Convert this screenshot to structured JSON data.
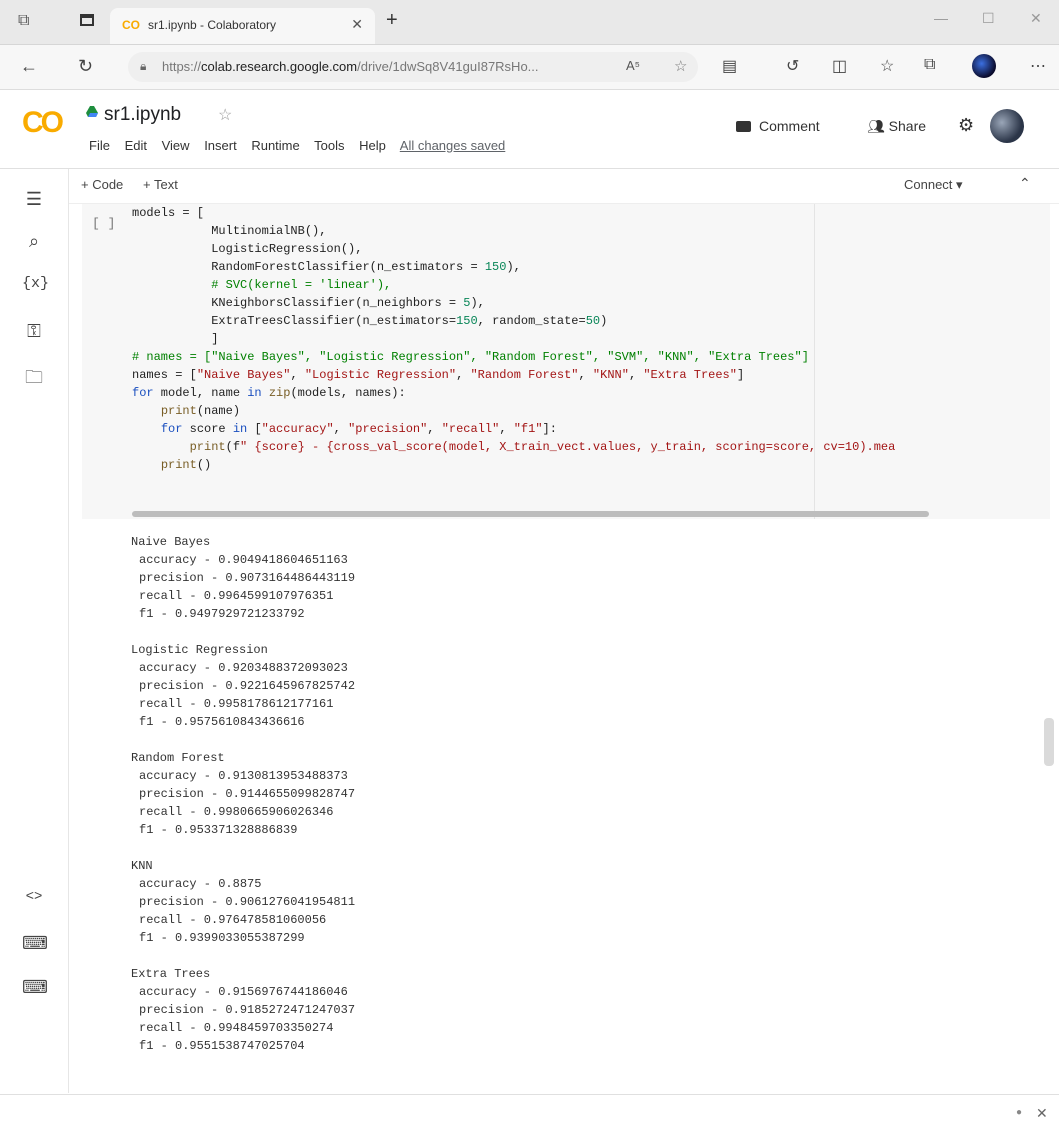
{
  "browser": {
    "tab_title": "sr1.ipynb - Colaboratory",
    "tab_favicon": "CO",
    "url_prefix": "https://",
    "url_host": "colab.research.google.com",
    "url_path": "/drive/1dwSq8V41guI87RsHo...",
    "reader_label": "A̶",
    "icons": [
      "workspaces-icon",
      "tab-actions-icon",
      "back-icon",
      "refresh-icon",
      "lock-icon",
      "read-aloud-icon",
      "favorite-icon",
      "extension-icon",
      "split-screen-icon",
      "favorites-icon",
      "collections-icon",
      "profile-icon",
      "more-icon"
    ]
  },
  "colab": {
    "logo": "CO",
    "notebook_title": "sr1.ipynb",
    "menu": [
      "File",
      "Edit",
      "View",
      "Insert",
      "Runtime",
      "Tools",
      "Help"
    ],
    "save_status": "All changes saved",
    "comment_label": "Comment",
    "share_label": "Share"
  },
  "toolbar": {
    "add_code": "+ Code",
    "add_text": "+ Text",
    "connect": "Connect",
    "run_indicator": "[ ]"
  },
  "code_lines": [
    "models = [",
    "           MultinomialNB(),",
    "           LogisticRegression(),",
    "           RandomForestClassifier(n_estimators = 150),",
    "           # SVC(kernel = 'linear'),",
    "           KNeighborsClassifier(n_neighbors = 5),",
    "           ExtraTreesClassifier(n_estimators=150, random_state=50)",
    "           ]",
    "# names = [\"Naive Bayes\", \"Logistic Regression\", \"Random Forest\", \"SVM\", \"KNN\", \"Extra Trees\"]",
    "names = [\"Naive Bayes\", \"Logistic Regression\", \"Random Forest\", \"KNN\", \"Extra Trees\"]",
    "for model, name in zip(models, names):",
    "    print(name)",
    "    for score in [\"accuracy\", \"precision\", \"recall\", \"f1\"]:",
    "        print(f\" {score} - {cross_val_score(model, X_train_vect.values, y_train, scoring=score, cv=10).mea",
    "    print()"
  ],
  "output": [
    {
      "name": "Naive Bayes",
      "metrics": [
        "accuracy - 0.9049418604651163",
        "precision - 0.9073164486443119",
        "recall - 0.9964599107976351",
        "f1 - 0.9497929721233792"
      ]
    },
    {
      "name": "Logistic Regression",
      "metrics": [
        "accuracy - 0.9203488372093023",
        "precision - 0.9221645967825742",
        "recall - 0.9958178612177161",
        "f1 - 0.9575610843436616"
      ]
    },
    {
      "name": "Random Forest",
      "metrics": [
        "accuracy - 0.9130813953488373",
        "precision - 0.9144655099828747",
        "recall - 0.9980665906026346",
        "f1 - 0.953371328886839"
      ]
    },
    {
      "name": "KNN",
      "metrics": [
        "accuracy - 0.8875",
        "precision - 0.9061276041954811",
        "recall - 0.976478581060056",
        "f1 - 0.9399033055387299"
      ]
    },
    {
      "name": "Extra Trees",
      "metrics": [
        "accuracy - 0.9156976744186046",
        "precision - 0.9185272471247037",
        "recall - 0.9948459703350274",
        "f1 - 0.9551538747025704"
      ]
    }
  ],
  "colors": {
    "colab_orange": "#f9ab00",
    "keyword": "#1a4fbf",
    "string": "#a31515",
    "comment": "#008000"
  }
}
